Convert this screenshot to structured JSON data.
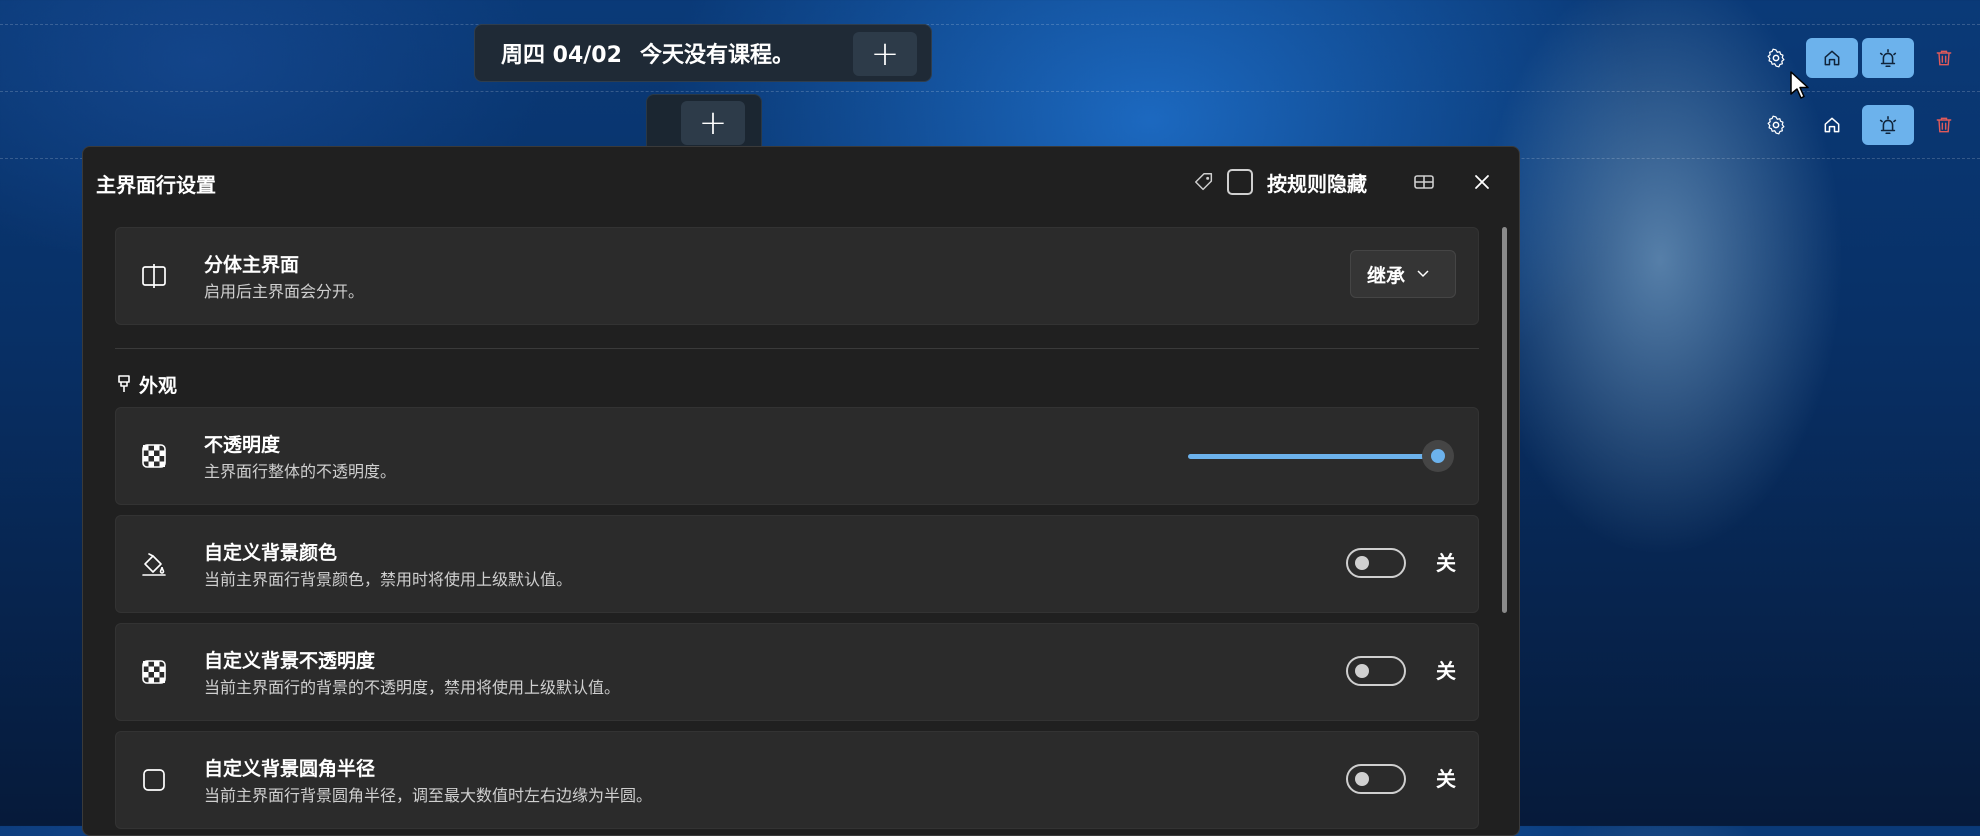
{
  "topbar": {
    "date": "周四 04/02",
    "message": "今天没有课程。",
    "add_icon": "plus-icon"
  },
  "addrow": {
    "add_icon": "plus-icon"
  },
  "row_controls": [
    {
      "settings": "gear-icon",
      "home": "home-icon",
      "alarm": "alarm-icon",
      "delete": "trash-icon",
      "home_active": true,
      "alarm_active": true
    },
    {
      "settings": "gear-icon",
      "home": "home-icon",
      "alarm": "alarm-icon",
      "delete": "trash-icon",
      "home_active": false,
      "alarm_active": true
    }
  ],
  "dialog": {
    "title": "主界面行设置",
    "hide_by_rule_label": "按规则隐藏",
    "hide_by_rule_checked": false,
    "split_main": {
      "title": "分体主界面",
      "desc": "启用后主界面会分开。",
      "value": "继承"
    },
    "appearance_section": "外观",
    "opacity": {
      "title": "不透明度",
      "desc": "主界面行整体的不透明度。",
      "value_percent": 100
    },
    "custom_bg_color": {
      "title": "自定义背景颜色",
      "desc": "当前主界面行背景颜色，禁用时将使用上级默认值。",
      "state": "关"
    },
    "custom_bg_opacity": {
      "title": "自定义背景不透明度",
      "desc": "当前主界面行的背景的不透明度，禁用将使用上级默认值。",
      "state": "关"
    },
    "custom_bg_radius": {
      "title": "自定义背景圆角半径",
      "desc": "当前主界面行背景圆角半径，调至最大数值时左右边缘为半圆。",
      "state": "关"
    }
  },
  "colors": {
    "accent": "#6cb2ec",
    "delete": "#e05a5a",
    "dialog_bg": "#202020",
    "card_bg": "#2b2b2b"
  }
}
